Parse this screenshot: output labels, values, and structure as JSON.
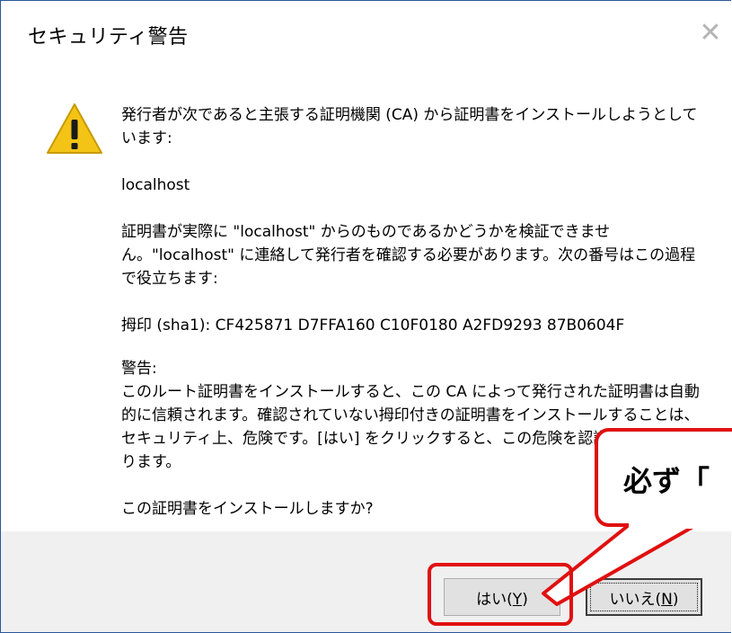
{
  "dialog": {
    "title": "セキュリティ警告",
    "close_glyph": "✕",
    "icon": "warning-triangle-icon",
    "intro": "発行者が次であると主張する証明機関 (CA) から証明書をインストールしようとしています:",
    "issuer": "localhost",
    "verify_text": "証明書が実際に \"localhost\" からのものであるかどうかを検証できません。\"localhost\" に連絡して発行者を確認する必要があります。次の番号はこの過程で役立ちます:",
    "thumbprint": "拇印 (sha1): CF425871 D7FFA160 C10F0180 A2FD9293 87B0604F",
    "warning_heading": "警告:",
    "warning_body": "このルート証明書をインストールすると、この CA によって発行された証明書は自動的に信頼されます。確認されていない拇印付きの証明書をインストールすることは、セキュリティ上、危険です。[はい] をクリックすると、この危険を認識したことになります。",
    "question": "この証明書をインストールしますか?",
    "yes_prefix": "はい(",
    "yes_key": "Y",
    "yes_suffix": ")",
    "no_prefix": "いいえ(",
    "no_key": "N",
    "no_suffix": ")"
  },
  "annotation": {
    "callout_text": "必ず「",
    "color": "#e01010"
  }
}
